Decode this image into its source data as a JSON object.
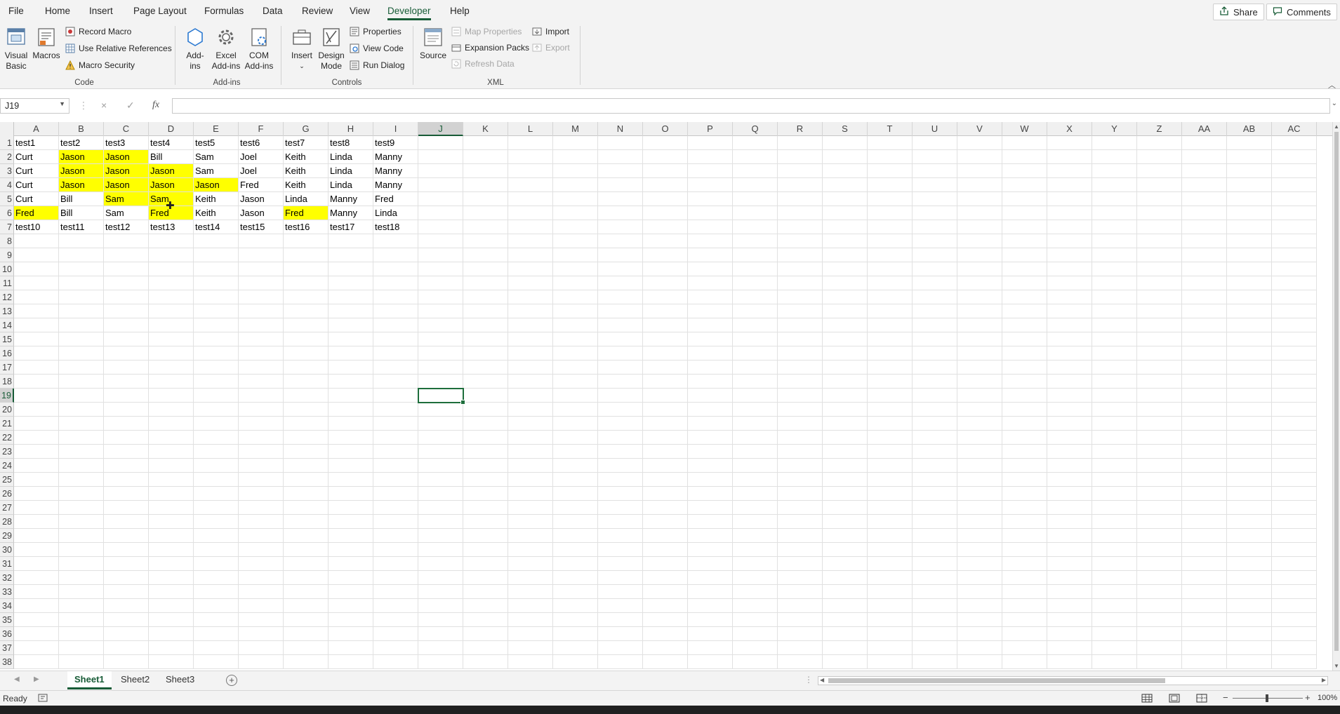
{
  "menu": {
    "tabs": [
      "File",
      "Home",
      "Insert",
      "Page Layout",
      "Formulas",
      "Data",
      "Review",
      "View",
      "Developer",
      "Help"
    ],
    "active_tab": "Developer",
    "share_label": "Share",
    "comments_label": "Comments"
  },
  "ribbon": {
    "code": {
      "label": "Code",
      "visual_basic": "Visual\nBasic",
      "macros": "Macros",
      "record_macro": "Record Macro",
      "use_relative_references": "Use Relative References",
      "macro_security": "Macro Security"
    },
    "addins": {
      "label": "Add-ins",
      "add_ins": "Add-\nins",
      "excel_add_ins": "Excel\nAdd-ins",
      "com_add_ins": "COM\nAdd-ins"
    },
    "controls": {
      "label": "Controls",
      "insert": "Insert",
      "design_mode": "Design\nMode",
      "properties": "Properties",
      "view_code": "View Code",
      "run_dialog": "Run Dialog"
    },
    "xml": {
      "label": "XML",
      "source": "Source",
      "map_properties": "Map Properties",
      "expansion_packs": "Expansion Packs",
      "refresh_data": "Refresh Data",
      "import": "Import",
      "export": "Export"
    }
  },
  "formula_bar": {
    "name_box": "J19",
    "cancel_icon": "×",
    "enter_icon": "✓",
    "fx_label": "fx",
    "content": ""
  },
  "sheet": {
    "columns": [
      "A",
      "B",
      "C",
      "D",
      "E",
      "F",
      "G",
      "H",
      "I",
      "J",
      "K",
      "L",
      "M",
      "N",
      "O",
      "P",
      "Q",
      "R",
      "S",
      "T",
      "U",
      "V",
      "W",
      "X",
      "Y",
      "Z",
      "AA",
      "AB",
      "AC"
    ],
    "row_count": 38,
    "selected_cell": "J19",
    "rows": [
      [
        "test1",
        "test2",
        "test3",
        "test4",
        "test5",
        "test6",
        "test7",
        "test8",
        "test9"
      ],
      [
        "Curt",
        "Jason",
        "Jason",
        "Bill",
        "Sam",
        "Joel",
        "Keith",
        "Linda",
        "Manny"
      ],
      [
        "Curt",
        "Jason",
        "Jason",
        "Jason",
        "Sam",
        "Joel",
        "Keith",
        "Linda",
        "Manny"
      ],
      [
        "Curt",
        "Jason",
        "Jason",
        "Jason",
        "Jason",
        "Fred",
        "Keith",
        "Linda",
        "Manny"
      ],
      [
        "Curt",
        "Bill",
        "Sam",
        "Sam",
        "Keith",
        "Jason",
        "Linda",
        "Manny",
        "Fred"
      ],
      [
        "Fred",
        "Bill",
        "Sam",
        "Fred",
        "Keith",
        "Jason",
        "Fred",
        "Manny",
        "Linda"
      ],
      [
        "test10",
        "test11",
        "test12",
        "test13",
        "test14",
        "test15",
        "test16",
        "test17",
        "test18"
      ]
    ],
    "highlighted": [
      "B2",
      "C2",
      "B3",
      "C3",
      "D3",
      "B4",
      "C4",
      "D4",
      "E4",
      "C5",
      "D5",
      "A6",
      "D6",
      "G6"
    ],
    "highlight_color": "#ffff00"
  },
  "sheet_tabs": {
    "tabs": [
      "Sheet1",
      "Sheet2",
      "Sheet3"
    ],
    "active": "Sheet1"
  },
  "status": {
    "ready": "Ready",
    "zoom": "100%"
  }
}
